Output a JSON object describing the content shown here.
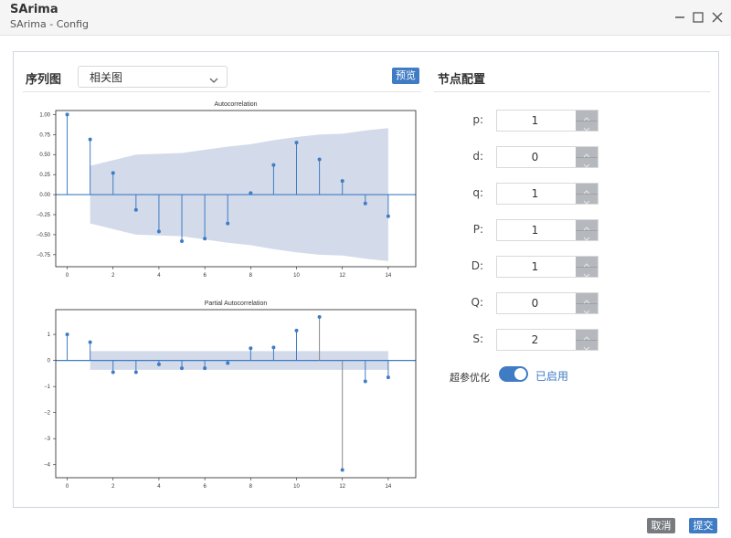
{
  "window": {
    "title": "SArima",
    "subtitle": "SArima - Config"
  },
  "left_header": {
    "label": "序列图",
    "select_value": "相关图",
    "preview_button": "预览"
  },
  "right_header": {
    "label": "节点配置"
  },
  "params": [
    {
      "label": "p:",
      "value": "1"
    },
    {
      "label": "d:",
      "value": "0"
    },
    {
      "label": "q:",
      "value": "1"
    },
    {
      "label": "P:",
      "value": "1"
    },
    {
      "label": "D:",
      "value": "1"
    },
    {
      "label": "Q:",
      "value": "0"
    },
    {
      "label": "S:",
      "value": "2"
    }
  ],
  "hyperparam": {
    "label": "超参优化",
    "status": "已启用",
    "enabled": true
  },
  "footer": {
    "cancel": "取消",
    "submit": "提交"
  },
  "colors": {
    "accent": "#3f7cc4",
    "stem": "#3f7cc4",
    "band": "#d3dae9",
    "gray_button": "#777b80"
  },
  "chart_data": [
    {
      "type": "stem",
      "title": "Autocorrelation",
      "x": [
        0,
        1,
        2,
        3,
        4,
        5,
        6,
        7,
        8,
        9,
        10,
        11,
        12,
        13,
        14
      ],
      "values": [
        1.0,
        0.69,
        0.27,
        -0.19,
        -0.46,
        -0.58,
        -0.55,
        -0.36,
        0.02,
        0.37,
        0.65,
        0.44,
        0.17,
        -0.11,
        -0.27
      ],
      "confidence_lower": [
        -0.36,
        -0.36,
        -0.43,
        -0.5,
        -0.51,
        -0.52,
        -0.56,
        -0.6,
        -0.63,
        -0.68,
        -0.72,
        -0.75,
        -0.76,
        -0.8,
        -0.83
      ],
      "confidence_upper": [
        0.36,
        0.36,
        0.43,
        0.5,
        0.51,
        0.52,
        0.56,
        0.6,
        0.63,
        0.68,
        0.72,
        0.75,
        0.76,
        0.8,
        0.83
      ],
      "ylim": [
        -0.9,
        1.05
      ],
      "xlim": [
        -0.5,
        15.2
      ],
      "yticks": [
        1.0,
        0.75,
        0.5,
        0.25,
        0.0,
        -0.25,
        -0.5,
        -0.75
      ],
      "ytick_labels": [
        "1.00",
        "0.75",
        "0.50",
        "0.25",
        "0.00",
        "−0.25",
        "−0.50",
        "−0.75"
      ],
      "xticks": [
        0,
        2,
        4,
        6,
        8,
        10,
        12,
        14
      ],
      "xtick_labels": [
        "0",
        "2",
        "4",
        "6",
        "8",
        "10",
        "12",
        "14"
      ]
    },
    {
      "type": "stem",
      "title": "Partial Autocorrelation",
      "x": [
        0,
        1,
        2,
        3,
        4,
        5,
        6,
        7,
        8,
        9,
        10,
        11,
        12,
        13,
        14
      ],
      "values": [
        1.0,
        0.7,
        -0.45,
        -0.45,
        -0.15,
        -0.3,
        -0.3,
        -0.1,
        0.47,
        0.5,
        1.15,
        1.67,
        -4.2,
        -0.8,
        -0.65
      ],
      "confidence_lower": [
        -0.36,
        -0.36,
        -0.36,
        -0.36,
        -0.36,
        -0.36,
        -0.36,
        -0.36,
        -0.36,
        -0.36,
        -0.36,
        -0.36,
        -0.36,
        -0.36,
        -0.36
      ],
      "confidence_upper": [
        0.36,
        0.36,
        0.36,
        0.36,
        0.36,
        0.36,
        0.36,
        0.36,
        0.36,
        0.36,
        0.36,
        0.36,
        0.36,
        0.36,
        0.36
      ],
      "ylim": [
        -4.5,
        1.95
      ],
      "xlim": [
        -0.5,
        15.2
      ],
      "yticks": [
        1,
        0,
        -1,
        -2,
        -3,
        -4
      ],
      "ytick_labels": [
        "1",
        "0",
        "−1",
        "−2",
        "−3",
        "−4"
      ],
      "xticks": [
        0,
        2,
        4,
        6,
        8,
        10,
        12,
        14
      ],
      "xtick_labels": [
        "0",
        "2",
        "4",
        "6",
        "8",
        "10",
        "12",
        "14"
      ]
    }
  ]
}
